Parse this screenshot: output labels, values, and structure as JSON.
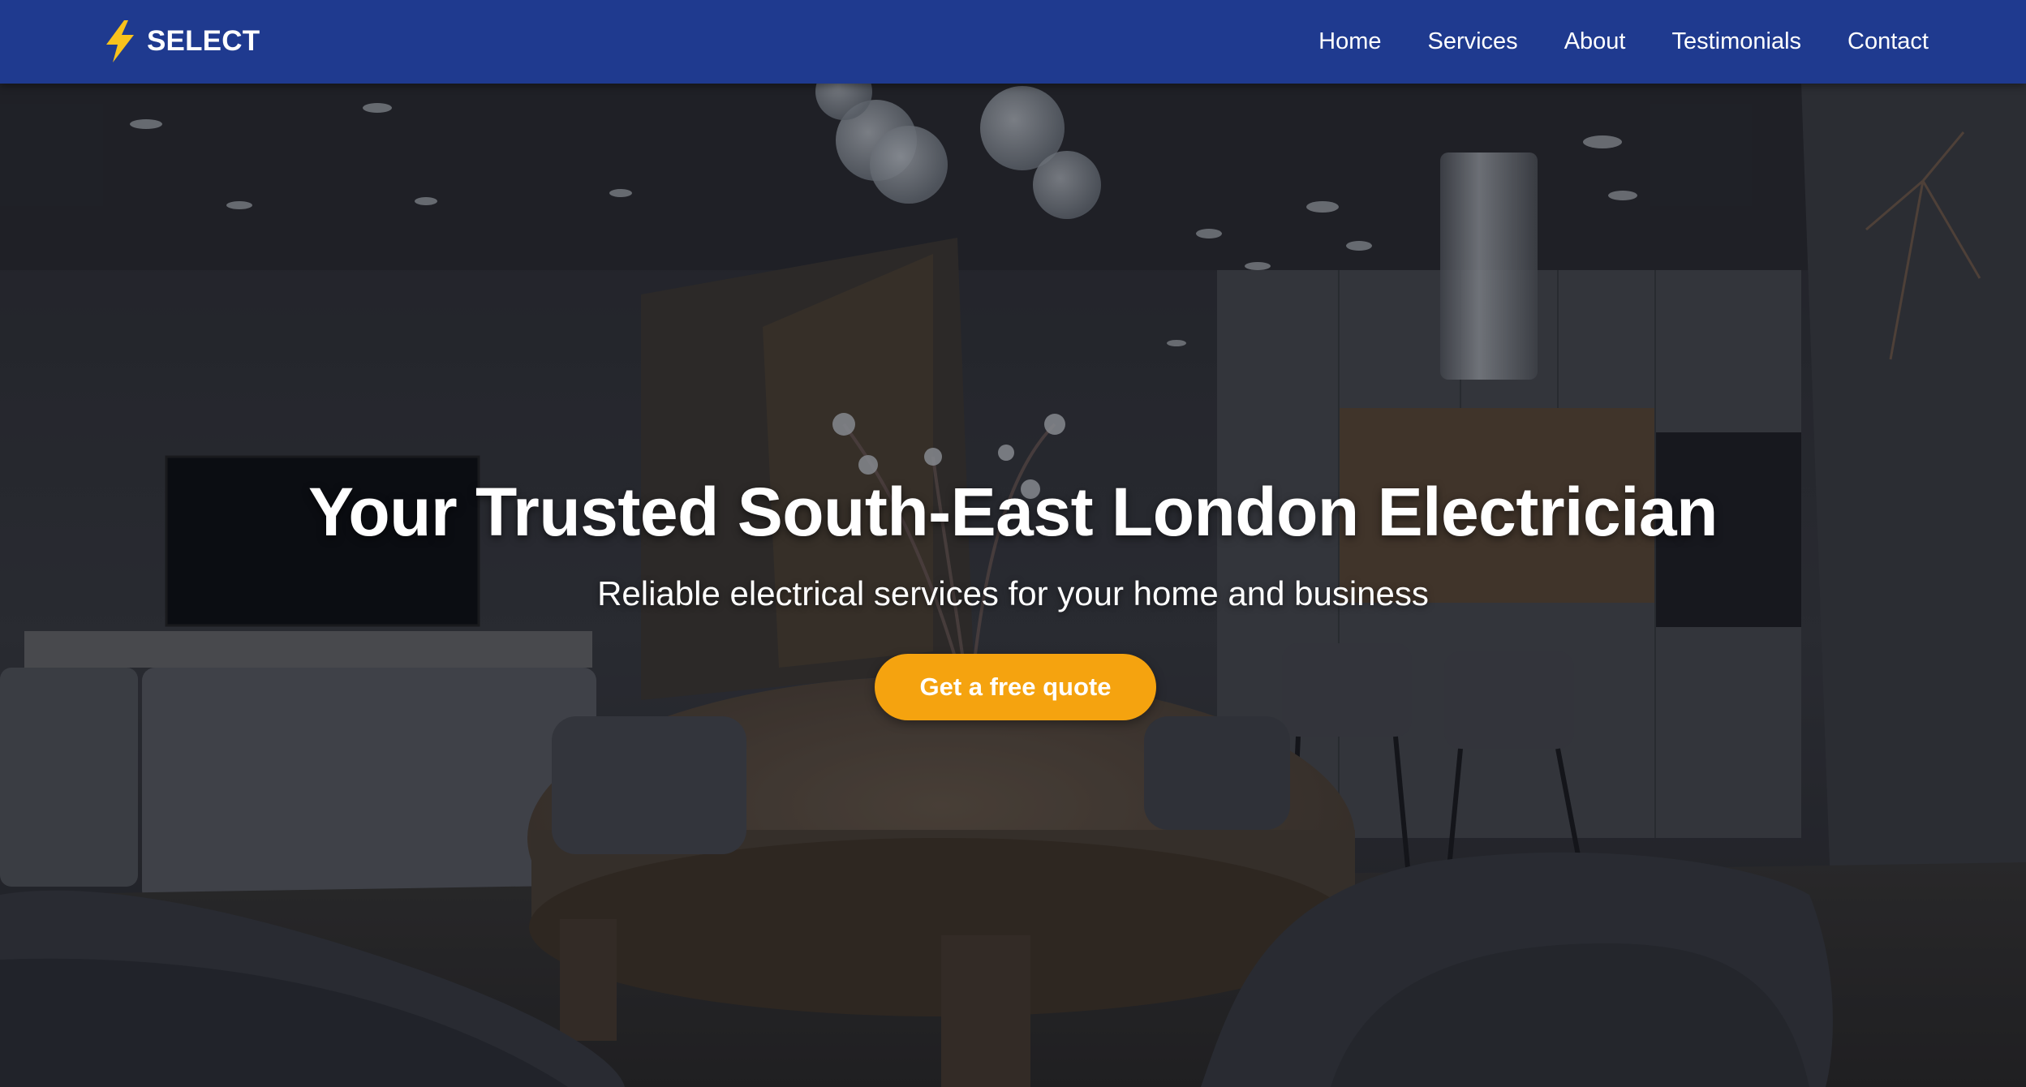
{
  "navbar": {
    "brand": {
      "icon": "lightning-bolt-icon",
      "name": "SELECT"
    },
    "links": [
      {
        "label": "Home"
      },
      {
        "label": "Services"
      },
      {
        "label": "About"
      },
      {
        "label": "Testimonials"
      },
      {
        "label": "Contact"
      }
    ]
  },
  "hero": {
    "title": "Your Trusted South-East London Electrician",
    "subtitle": "Reliable electrical services for your home and business",
    "cta_label": "Get a free quote"
  },
  "colors": {
    "nav_background": "#1f3a8f",
    "accent": "#f5a30f",
    "icon_yellow": "#f8c21c",
    "text": "#ffffff"
  }
}
